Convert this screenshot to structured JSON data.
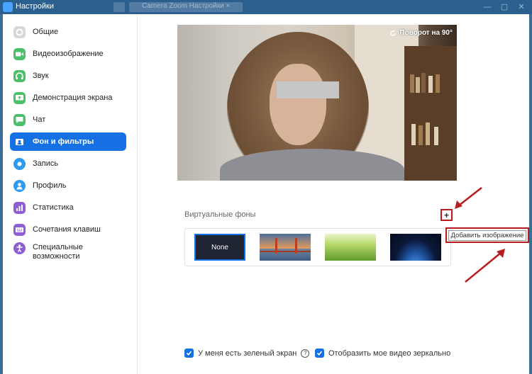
{
  "window": {
    "title": "Настройки",
    "background_tab_text": "Camera Zoom Настройки ×"
  },
  "sidebar": {
    "items": [
      {
        "label": "Общие",
        "icon": "gear-icon",
        "color": "#d7d7d7"
      },
      {
        "label": "Видеоизображение",
        "icon": "video-camera-icon",
        "color": "#4cbf6b"
      },
      {
        "label": "Звук",
        "icon": "headphones-icon",
        "color": "#4cbf6b"
      },
      {
        "label": "Демонстрация экрана",
        "icon": "share-screen-icon",
        "color": "#4cbf6b"
      },
      {
        "label": "Чат",
        "icon": "chat-icon",
        "color": "#4cbf6b"
      },
      {
        "label": "Фон и фильтры",
        "icon": "background-filters-icon",
        "color": "#1470e3"
      },
      {
        "label": "Запись",
        "icon": "record-icon",
        "color": "#2e9bf0"
      },
      {
        "label": "Профиль",
        "icon": "profile-icon",
        "color": "#2e9bf0"
      },
      {
        "label": "Статистика",
        "icon": "statistics-icon",
        "color": "#8e5fd4"
      },
      {
        "label": "Сочетания клавиш",
        "icon": "keyboard-icon",
        "color": "#8e5fd4"
      },
      {
        "label": "Специальные возможности",
        "icon": "accessibility-icon",
        "color": "#8e5fd4"
      }
    ],
    "active_index": 5
  },
  "main": {
    "rotate_label": "Поворот на 90°",
    "virtual_backgrounds_label": "Виртуальные фоны",
    "add_image_tooltip": "Добавить изображение",
    "thumbnails": [
      {
        "label": "None",
        "kind": "none",
        "selected": true
      },
      {
        "label": "",
        "kind": "golden-gate-bridge"
      },
      {
        "label": "",
        "kind": "grass"
      },
      {
        "label": "",
        "kind": "earth-from-space"
      }
    ],
    "checkboxes": [
      {
        "label": "У меня есть зеленый экран",
        "checked": true
      },
      {
        "label": "Отобразить мое видео зеркально",
        "checked": true
      }
    ]
  },
  "colors": {
    "accent": "#1470e3",
    "annotation_red": "#b81c1c",
    "titlebar": "#2b5f8e"
  }
}
